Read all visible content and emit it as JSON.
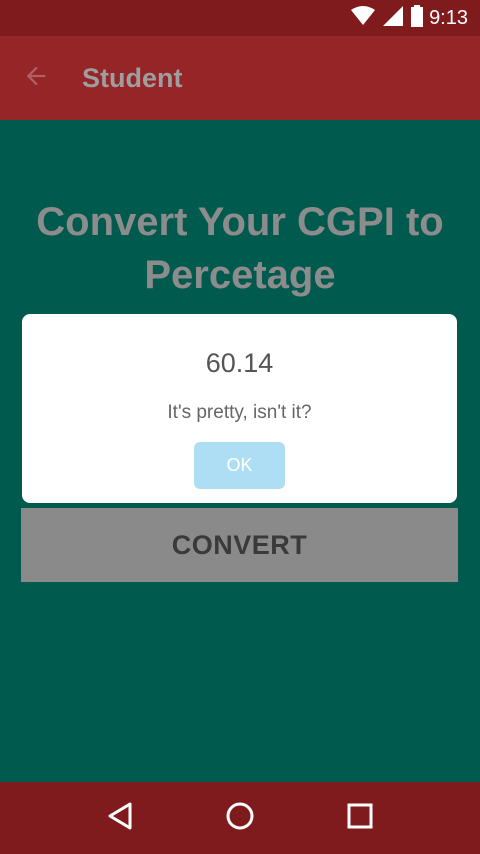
{
  "status_bar": {
    "time": "9:13",
    "icons": [
      "wifi-icon",
      "signal-icon",
      "battery-icon"
    ]
  },
  "toolbar": {
    "title": "Student",
    "back_icon": "arrow-left-icon"
  },
  "main": {
    "headline": "Convert Your CGPI to Percetage",
    "convert_label": "CONVERT"
  },
  "dialog": {
    "title": "60.14",
    "message": "It's pretty, isn't it?",
    "ok_label": "OK"
  },
  "nav_bar": {
    "icons": [
      "back-triangle-icon",
      "home-circle-icon",
      "recents-square-icon"
    ]
  },
  "colors": {
    "status_bar": "#7f1b1c",
    "toolbar": "#952526",
    "content_bg": "#005a4e",
    "nav_bar": "#801b1d",
    "ok_button": "#aedef4"
  }
}
